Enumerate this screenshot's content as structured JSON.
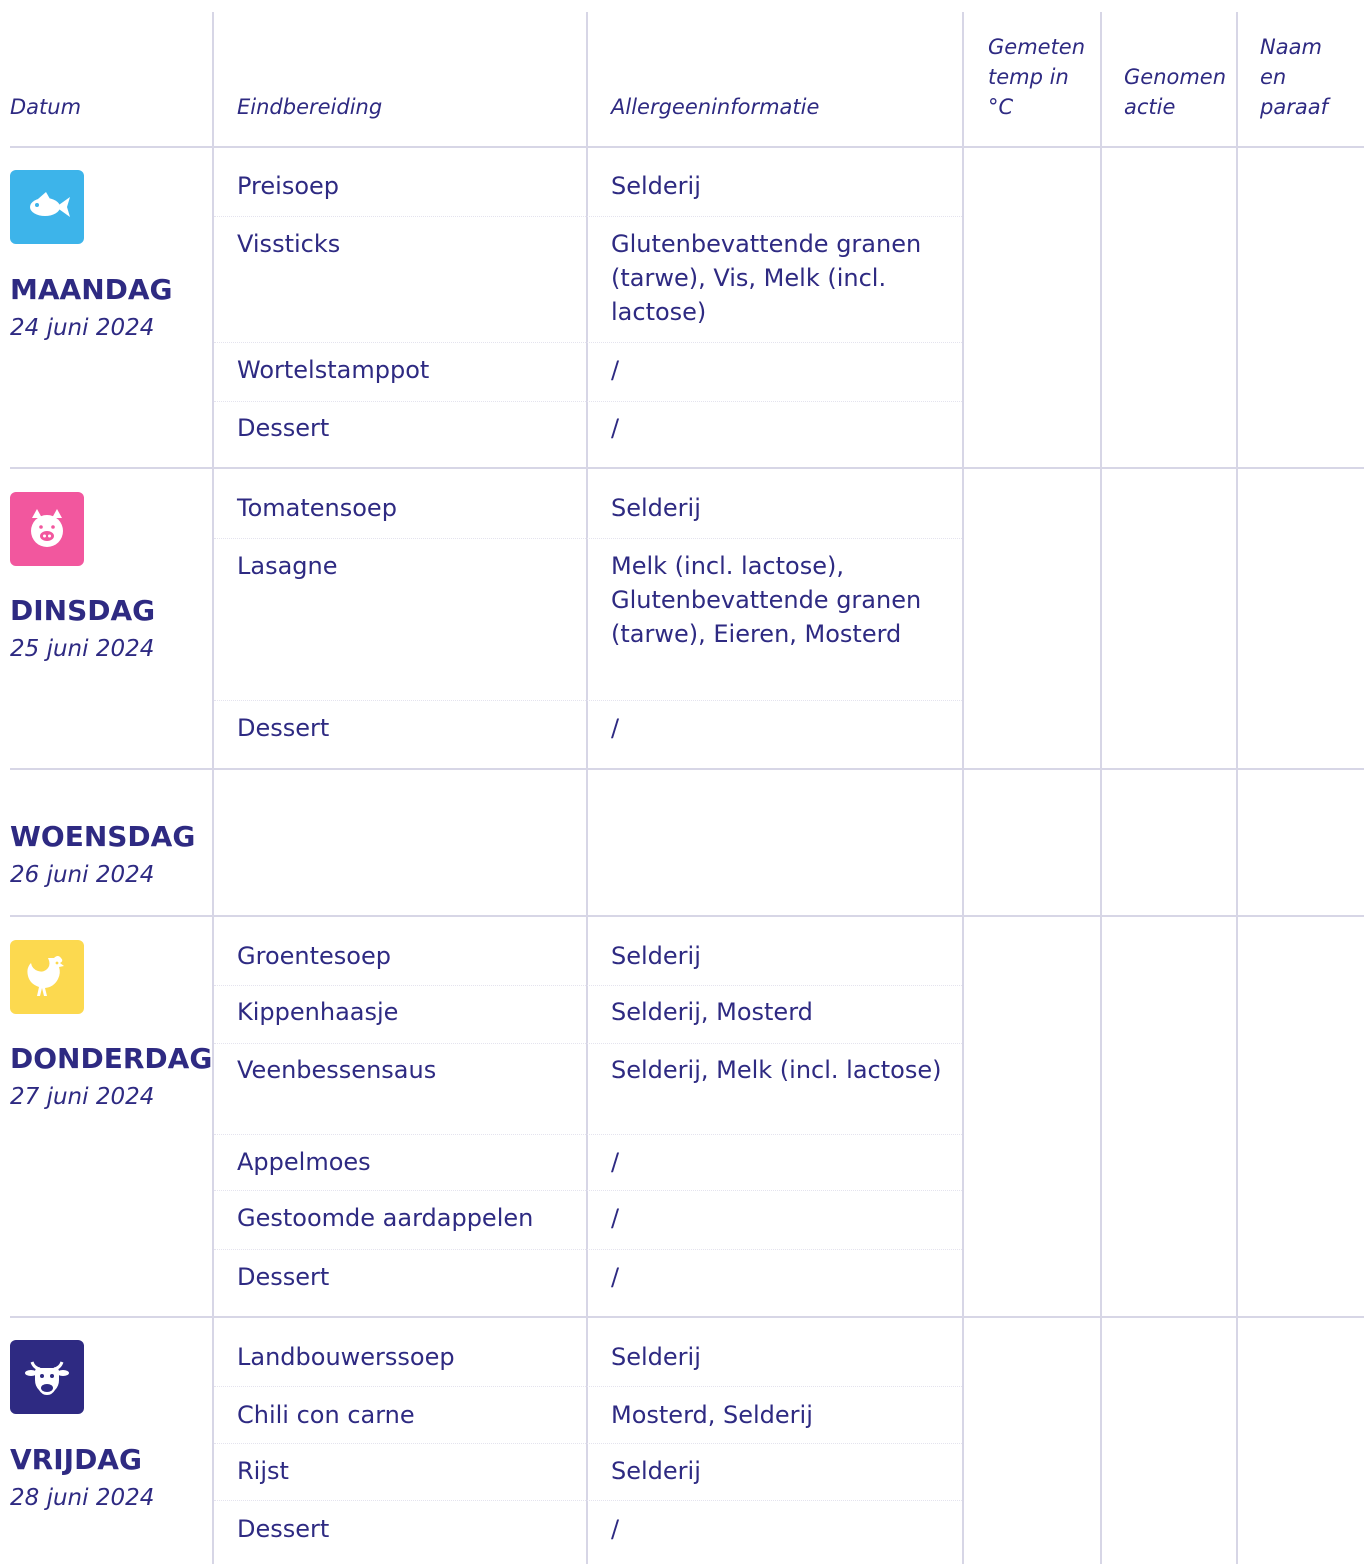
{
  "header": {
    "datum": "Datum",
    "eindbereiding": "Eindbereiding",
    "allergeen": "Allergeeninformatie",
    "temp_lines": [
      "Gemeten",
      "temp in",
      "°C"
    ],
    "actie_lines": [
      "Genomen",
      "actie"
    ],
    "naam_lines": [
      "Naam",
      "en",
      "paraaf"
    ]
  },
  "days": [
    {
      "name": "MAANDAG",
      "date": "24 juni 2024",
      "icon": "fish-icon",
      "icon_color": "#3db4ea",
      "dishes": [
        {
          "name": "Preisoep",
          "allergens": "Selderij"
        },
        {
          "name": "Vissticks",
          "allergens": "Glutenbevattende granen (tarwe), Vis, Melk (incl. lactose)"
        },
        {
          "name": "Wortelstamppot",
          "allergens": "/"
        },
        {
          "name": "Dessert",
          "allergens": "/"
        }
      ]
    },
    {
      "name": "DINSDAG",
      "date": "25 juni 2024",
      "icon": "pig-icon",
      "icon_color": "#f2579e",
      "dishes": [
        {
          "name": "Tomatensoep",
          "allergens": "Selderij"
        },
        {
          "name": "Lasagne",
          "allergens": "Melk (incl. lactose), Glutenbevattende granen (tarwe), Eieren, Mosterd"
        },
        {
          "name": "Dessert",
          "allergens": "/"
        }
      ]
    },
    {
      "name": "WOENSDAG",
      "date": "26 juni 2024",
      "dishes": []
    },
    {
      "name": "DONDERDAG",
      "date": "27 juni 2024",
      "icon": "rooster-icon",
      "icon_color": "#fcd94f",
      "dishes": [
        {
          "name": "Groentesoep",
          "allergens": "Selderij"
        },
        {
          "name": "Kippenhaasje",
          "allergens": "Selderij, Mosterd"
        },
        {
          "name": "Veenbessensaus",
          "allergens": "Selderij, Melk (incl. lactose)"
        },
        {
          "name": "Appelmoes",
          "allergens": "/"
        },
        {
          "name": "Gestoomde aardappelen",
          "allergens": "/"
        },
        {
          "name": "Dessert",
          "allergens": "/"
        }
      ]
    },
    {
      "name": "VRIJDAG",
      "date": "28 juni 2024",
      "icon": "cow-icon",
      "icon_color": "#2e2a82",
      "dishes": [
        {
          "name": "Landbouwerssoep",
          "allergens": "Selderij"
        },
        {
          "name": "Chili con carne",
          "allergens": "Mosterd, Selderij"
        },
        {
          "name": "Rijst",
          "allergens": "Selderij"
        },
        {
          "name": "Dessert",
          "allergens": "/"
        }
      ]
    }
  ]
}
